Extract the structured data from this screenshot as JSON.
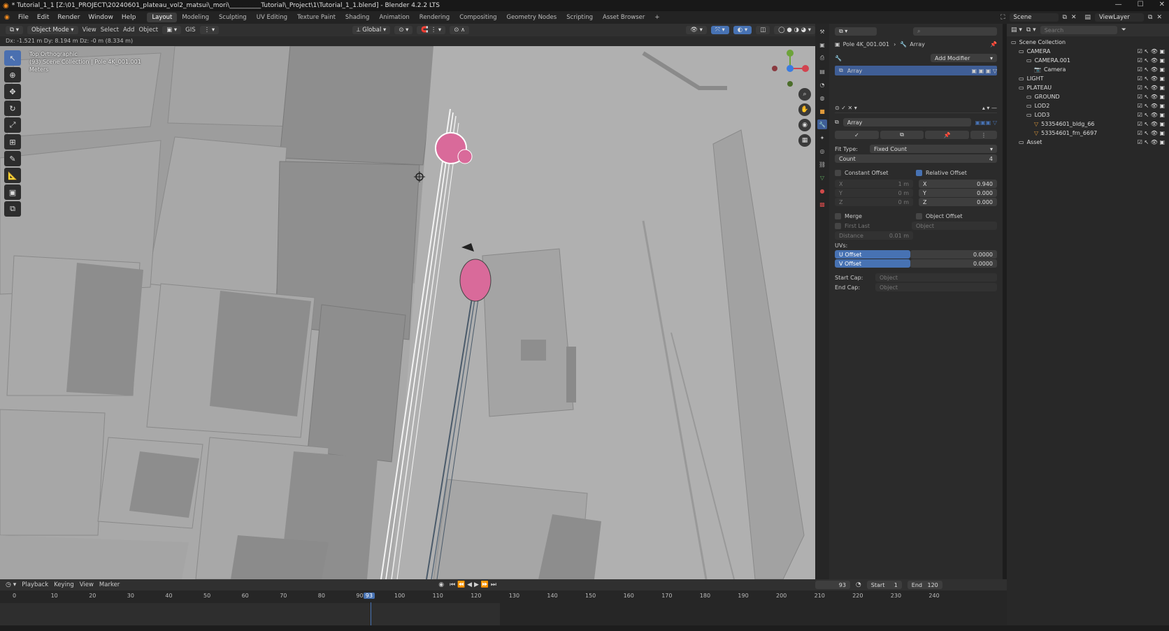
{
  "titlebar": {
    "title": "* Tutorial_1_1 [Z:\\01_PROJECT\\20240601_plateau_vol2_matsui\\_mori\\__________Tutorial\\_Project\\1\\Tutorial_1_1.blend] - Blender 4.2.2 LTS",
    "min": "—",
    "max": "☐",
    "close": "✕"
  },
  "menu": {
    "items": [
      "File",
      "Edit",
      "Render",
      "Window",
      "Help"
    ],
    "workspaces": [
      "Layout",
      "Modeling",
      "Sculpting",
      "UV Editing",
      "Texture Paint",
      "Shading",
      "Animation",
      "Rendering",
      "Compositing",
      "Geometry Nodes",
      "Scripting",
      "Asset Browser"
    ],
    "active_workspace": "Layout",
    "add": "+",
    "scene": "Scene",
    "view_layer": "ViewLayer"
  },
  "viewport_header": {
    "mode": "Object Mode",
    "menus": [
      "View",
      "Select",
      "Add",
      "Object"
    ],
    "gis": "GIS",
    "orientation": "Global"
  },
  "status_line": "Dx: -1.521 m   Dy: 8.194 m   Dz: -0 m (8.334 m)",
  "viewport_info": {
    "view": "Top Orthographic",
    "collection": "(93) Scene Collection | Pole 4K_001.001",
    "units": "Meters"
  },
  "toolbar": {
    "tools": [
      {
        "name": "select-tool",
        "glyph": "↖",
        "active": true
      },
      {
        "name": "cursor-tool",
        "glyph": "⊕"
      },
      {
        "name": "move-tool",
        "glyph": "✥"
      },
      {
        "name": "rotate-tool",
        "glyph": "↻"
      },
      {
        "name": "scale-tool",
        "glyph": "⤢"
      },
      {
        "name": "transform-tool",
        "glyph": "⊞"
      },
      {
        "name": "annotate-tool",
        "glyph": "✎"
      },
      {
        "name": "measure-tool",
        "glyph": "📐"
      },
      {
        "name": "add-cube-tool",
        "glyph": "▣"
      },
      {
        "name": "extra-tool",
        "glyph": "⧉"
      }
    ]
  },
  "gizmo": {
    "x": "X",
    "y": "Y",
    "z": "Z"
  },
  "properties": {
    "breadcrumb_object": "Pole 4K_001.001",
    "breadcrumb_modifier": "Array",
    "add_modifier": "Add Modifier",
    "stack_item": "Array",
    "modifier_name": "Array",
    "fit_type_label": "Fit Type:",
    "fit_type": "Fixed Count",
    "count_label": "Count",
    "count": "4",
    "constant_offset": "Constant Offset",
    "relative_offset": "Relative Offset",
    "const": {
      "x_label": "X",
      "x": "1 m",
      "y_label": "Y",
      "y": "0 m",
      "z_label": "Z",
      "z": "0 m"
    },
    "rel": {
      "x_label": "X",
      "x": "0.940",
      "y_label": "Y",
      "y": "0.000",
      "z_label": "Z",
      "z": "0.000"
    },
    "merge": "Merge",
    "first_last": "First Last",
    "distance_label": "Distance",
    "distance": "0.01 m",
    "object_offset": "Object Offset",
    "object_placeholder": "Object",
    "uvs": "UVs:",
    "u_offset_label": "U Offset",
    "u_offset": "0.0000",
    "v_offset_label": "V Offset",
    "v_offset": "0.0000",
    "start_cap": "Start Cap:",
    "end_cap": "End Cap:",
    "cap_placeholder": "Object"
  },
  "outliner": {
    "search": "Search",
    "title": "Scene Collection",
    "rows": [
      {
        "label": "CAMERA",
        "indent": 1,
        "kind": "collection"
      },
      {
        "label": "CAMERA.001",
        "indent": 2,
        "kind": "collection"
      },
      {
        "label": "Camera",
        "indent": 3,
        "kind": "camera"
      },
      {
        "label": "LIGHT",
        "indent": 1,
        "kind": "collection"
      },
      {
        "label": "PLATEAU",
        "indent": 1,
        "kind": "collection"
      },
      {
        "label": "GROUND",
        "indent": 2,
        "kind": "collection"
      },
      {
        "label": "LOD2",
        "indent": 2,
        "kind": "collection"
      },
      {
        "label": "LOD3",
        "indent": 2,
        "kind": "collection"
      },
      {
        "label": "53354601_bldg_66",
        "indent": 3,
        "kind": "mesh"
      },
      {
        "label": "53354601_frn_6697",
        "indent": 3,
        "kind": "mesh"
      },
      {
        "label": "Asset",
        "indent": 1,
        "kind": "collection"
      }
    ]
  },
  "timeline": {
    "menus": [
      "Playback",
      "Keying",
      "View",
      "Marker"
    ],
    "current_frame": "93",
    "start_label": "Start",
    "start": "1",
    "end_label": "End",
    "end": "120",
    "ticks": [
      "0",
      "10",
      "20",
      "30",
      "40",
      "50",
      "60",
      "70",
      "80",
      "90",
      "100",
      "110",
      "120",
      "130",
      "140",
      "150",
      "160",
      "170",
      "180",
      "190",
      "200",
      "210",
      "220",
      "230",
      "240"
    ]
  },
  "colors": {
    "accent": "#4772b3",
    "selected_mesh": "#d96a9a",
    "viewport_bg": "#a9a9a9"
  }
}
